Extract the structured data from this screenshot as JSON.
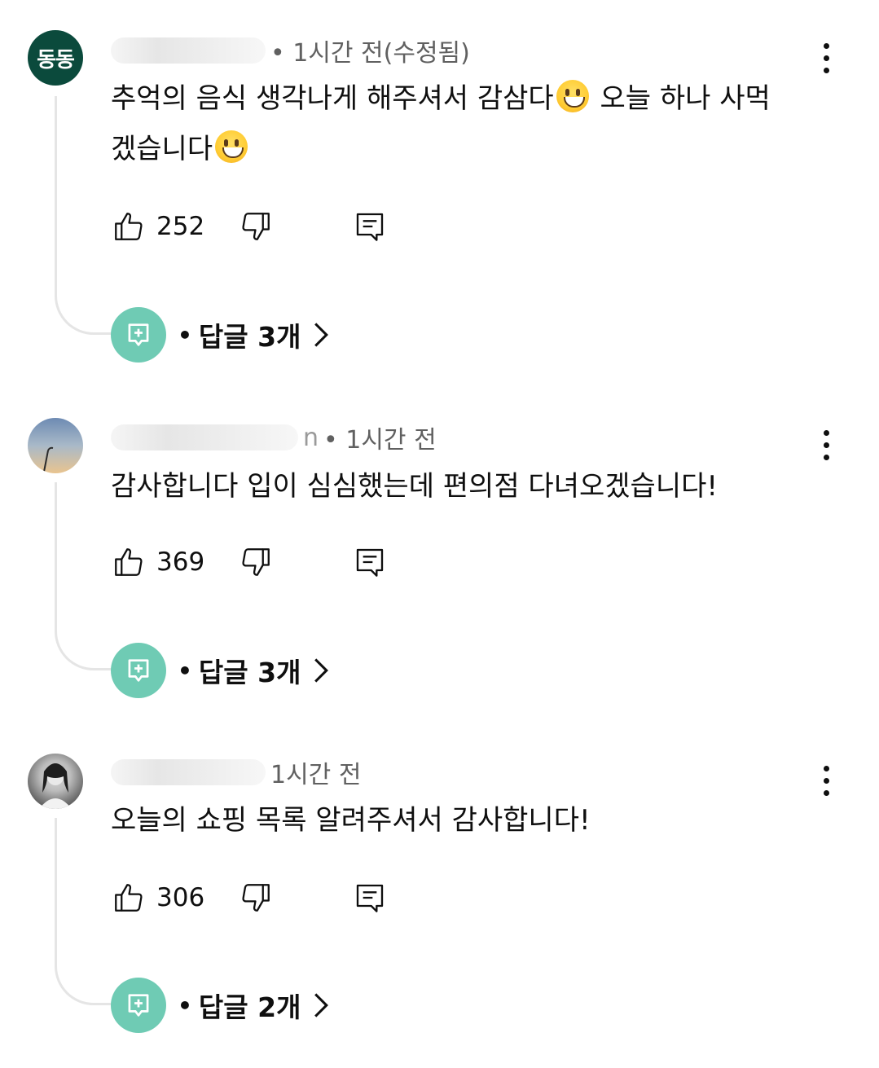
{
  "comments": [
    {
      "avatar_initials": "동동",
      "avatar_style": "initials",
      "meta": "• 1시간 전(수정됨)",
      "text_part1": "추억의 음식 생각나게 해주셔서 감삼다",
      "text_part2": " 오늘 하나 사먹겠습니다",
      "likes": "252",
      "replies_label": "답글 3개"
    },
    {
      "avatar_style": "sky",
      "meta_prefix": "n",
      "meta": "• 1시간 전",
      "text_part1": "감사합니다 입이 심심했는데 편의점 다녀오겠습니다!",
      "likes": "369",
      "replies_label": "답글 3개"
    },
    {
      "avatar_style": "person",
      "meta": "1시간 전",
      "text_part1": "오늘의 쇼핑 목록 알려주셔서 감사합니다!",
      "likes": "306",
      "replies_label": "답글 2개"
    }
  ],
  "replies_bullet": "•",
  "icons": {
    "like": "thumbs-up-icon",
    "dislike": "thumbs-down-icon",
    "reply": "comment-icon",
    "more": "more-vert-icon",
    "replies": "add-reply-icon",
    "chevron": "chevron-right-icon"
  },
  "colors": {
    "initials_avatar": "#0b4a3c",
    "reply_badge": "#6fcbb4",
    "meta_text": "#606060",
    "thread_line": "#e5e5e5"
  }
}
